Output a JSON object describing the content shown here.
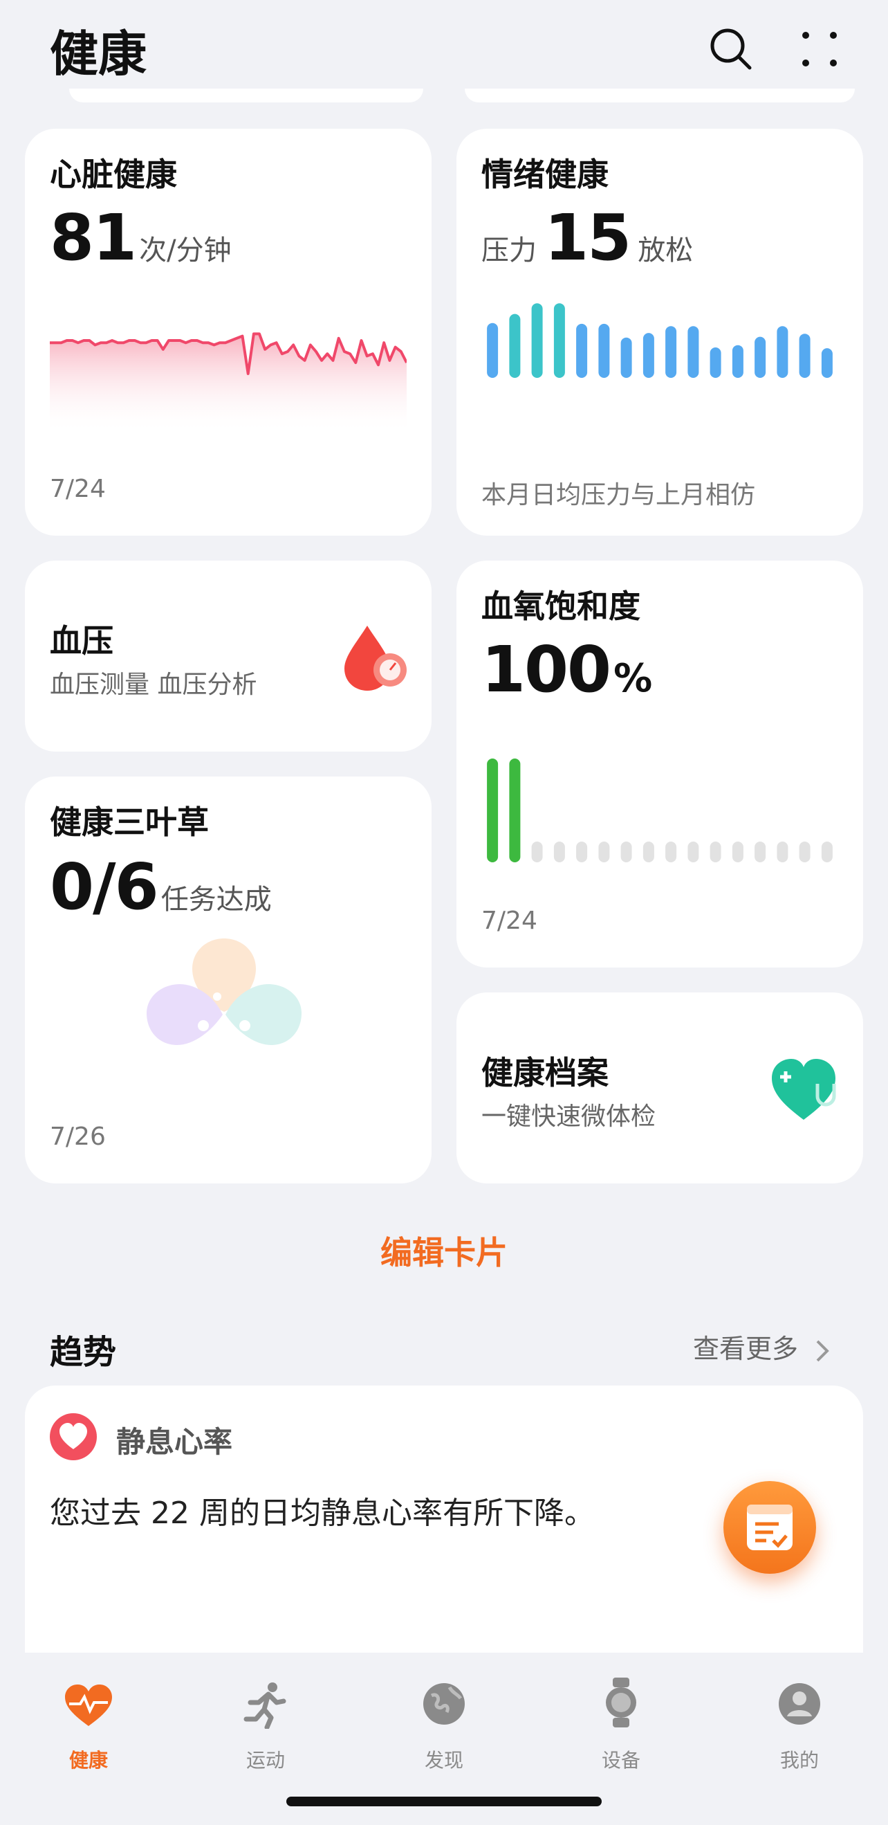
{
  "header": {
    "title": "健康",
    "search_icon": "search-icon",
    "menu_icon": "more-dots-icon"
  },
  "cards": {
    "heart": {
      "title": "心脏健康",
      "value": "81",
      "unit": "次/分钟",
      "date": "7/24",
      "color": "#F0486A",
      "series": [
        6,
        6,
        6,
        5,
        5,
        6,
        5,
        5,
        7,
        6,
        6,
        5,
        6,
        6,
        5,
        5,
        6,
        6,
        5,
        5,
        9,
        5,
        5,
        5,
        6,
        5,
        5,
        6,
        6,
        7,
        6,
        6,
        5,
        4,
        3,
        20,
        2,
        2,
        9,
        7,
        6,
        11,
        10,
        7,
        12,
        14,
        7,
        10,
        14,
        11,
        14,
        4,
        10,
        11,
        15,
        5,
        12,
        11,
        16,
        6,
        14,
        8,
        10,
        15
      ]
    },
    "emotion": {
      "title": "情绪健康",
      "prefix": "压力",
      "value": "15",
      "suffix": "放松",
      "note": "本月日均压力与上月相仿",
      "bars": [
        72,
        84,
        98,
        98,
        71,
        71,
        53,
        59,
        68,
        68,
        40,
        43,
        54,
        68,
        58,
        39
      ],
      "bar_colors": [
        "#55A9F0",
        "#3CC4C9",
        "#3CC4C9",
        "#3CC4C9",
        "#55A9F0",
        "#55A9F0",
        "#55A9F0",
        "#55A9F0",
        "#55A9F0",
        "#55A9F0",
        "#55A9F0",
        "#55A9F0",
        "#55A9F0",
        "#55A9F0",
        "#55A9F0",
        "#55A9F0"
      ]
    },
    "bp": {
      "title": "血压",
      "subtitle": "血压测量 血压分析",
      "icon": "blood-drop-gauge-icon"
    },
    "spo2": {
      "title": "血氧饱和度",
      "value": "100",
      "unit": "%",
      "date": "7/24",
      "bars": [
        1,
        1,
        0,
        0,
        0,
        0,
        0,
        0,
        0,
        0,
        0,
        0,
        0,
        0,
        0,
        0
      ],
      "accent": "#3DB93F"
    },
    "clover": {
      "title": "健康三叶草",
      "value": "0/6",
      "unit": "任务达成",
      "date": "7/26",
      "completed": 0,
      "total": 6
    },
    "record": {
      "title": "健康档案",
      "subtitle": "一键快速微体检",
      "icon": "heart-stethoscope-icon"
    }
  },
  "edit_cards": "编辑卡片",
  "trends": {
    "title": "趋势",
    "more": "查看更多",
    "item": {
      "name": "静息心率",
      "text": "您过去 22 周的日均静息心率有所下降。"
    }
  },
  "accent": "#F26B21",
  "tabs": [
    {
      "label": "健康",
      "icon": "heart-pulse-icon",
      "active": true
    },
    {
      "label": "运动",
      "icon": "running-icon",
      "active": false
    },
    {
      "label": "发现",
      "icon": "globe-icon",
      "active": false
    },
    {
      "label": "设备",
      "icon": "watch-icon",
      "active": false
    },
    {
      "label": "我的",
      "icon": "profile-icon",
      "active": false
    }
  ]
}
